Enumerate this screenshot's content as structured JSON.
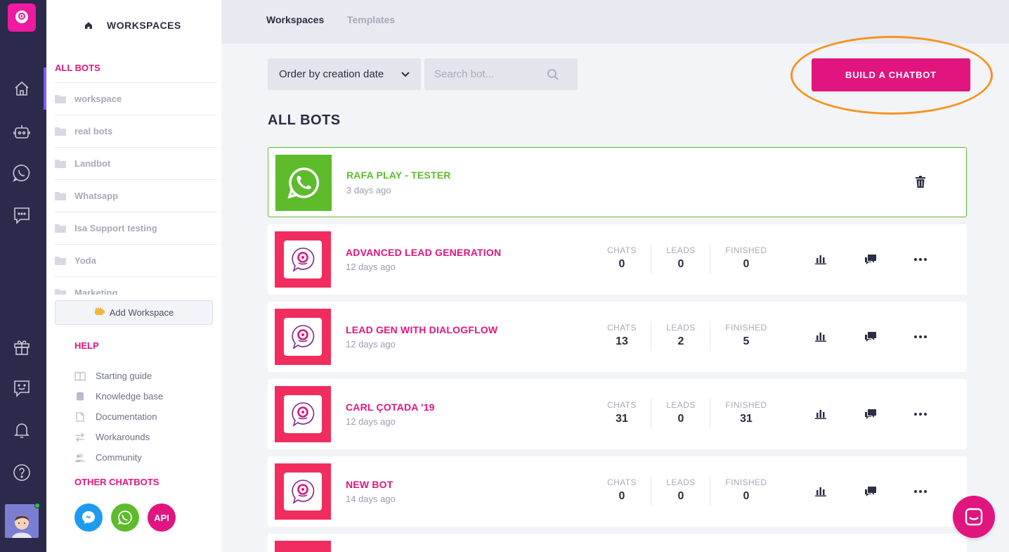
{
  "sidebar": {
    "title": "WORKSPACES",
    "all_bots": "ALL BOTS",
    "workspaces": [
      "workspace",
      "real bots",
      "Landbot",
      "Whatsapp",
      "Isa Support testing",
      "Yoda",
      "Marketing"
    ],
    "add_workspace": "Add Workspace",
    "help_title": "HELP",
    "help_items": [
      "Starting guide",
      "Knowledge base",
      "Documentation",
      "Workarounds",
      "Community"
    ],
    "other_title": "OTHER CHATBOTS",
    "api_label": "API"
  },
  "tabs": {
    "workspaces": "Workspaces",
    "templates": "Templates"
  },
  "controls": {
    "order_label": "Order by creation date",
    "search_placeholder": "Search bot...",
    "build_label": "BUILD A CHATBOT"
  },
  "section_title": "ALL BOTS",
  "stat_labels": {
    "chats": "CHATS",
    "leads": "LEADS",
    "finished": "FINISHED"
  },
  "bots": [
    {
      "name": "RAFA PLAY - TESTER",
      "date": "3 days ago"
    },
    {
      "name": "ADVANCED LEAD GENERATION",
      "date": "12 days ago",
      "chats": "0",
      "leads": "0",
      "finished": "0"
    },
    {
      "name": "LEAD GEN WITH DIALOGFLOW",
      "date": "12 days ago",
      "chats": "13",
      "leads": "2",
      "finished": "5"
    },
    {
      "name": "CARL ÇOTADA '19",
      "date": "12 days ago",
      "chats": "31",
      "leads": "0",
      "finished": "31"
    },
    {
      "name": "NEW BOT",
      "date": "14 days ago",
      "chats": "0",
      "leads": "0",
      "finished": "0"
    }
  ],
  "colors": {
    "brand": "#e0157e",
    "whatsapp": "#5dbb2c",
    "highlight": "#f7931e",
    "rail": "#2b2a4a"
  }
}
